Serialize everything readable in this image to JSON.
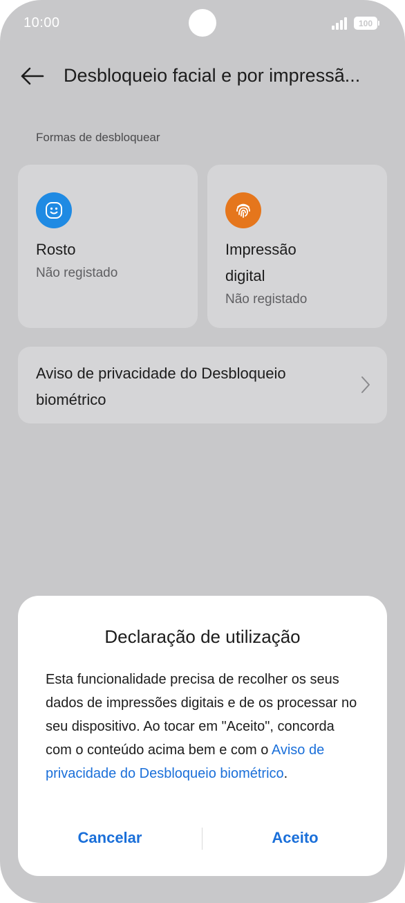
{
  "status_bar": {
    "time": "10:00",
    "battery": "100",
    "icons": [
      "signal-icon",
      "battery-icon"
    ]
  },
  "header": {
    "title": "Desbloqueio facial e por impressã...",
    "back_icon": "back-arrow-icon"
  },
  "section": {
    "label": "Formas de desbloquear"
  },
  "unlock_methods": [
    {
      "title": "Rosto",
      "status": "Não registado",
      "icon": "face-icon",
      "icon_color": "#1f8ae3"
    },
    {
      "title_line1": "Impressão",
      "title_line2": "digital",
      "status": "Não registado",
      "icon": "fingerprint-icon",
      "icon_color": "#e5761c"
    }
  ],
  "privacy_row": {
    "label": "Aviso de privacidade do Desbloqueio biométrico",
    "icon": "chevron-right-icon"
  },
  "dialog": {
    "title": "Declaração de utilização",
    "body_text": "Esta funcionalidade precisa de recolher os seus dados de impressões digitais e de os processar no seu dispositivo. Ao tocar em \"Aceito\", concorda com o conteúdo acima bem e com o ",
    "body_link": "Aviso de privacidade do Desbloqueio biométrico",
    "body_end": ".",
    "cancel_label": "Cancelar",
    "accept_label": "Aceito"
  },
  "colors": {
    "accent": "#1a6fd9",
    "scrim_background": "#c8c8ca",
    "card_background": "#d5d5d7"
  }
}
